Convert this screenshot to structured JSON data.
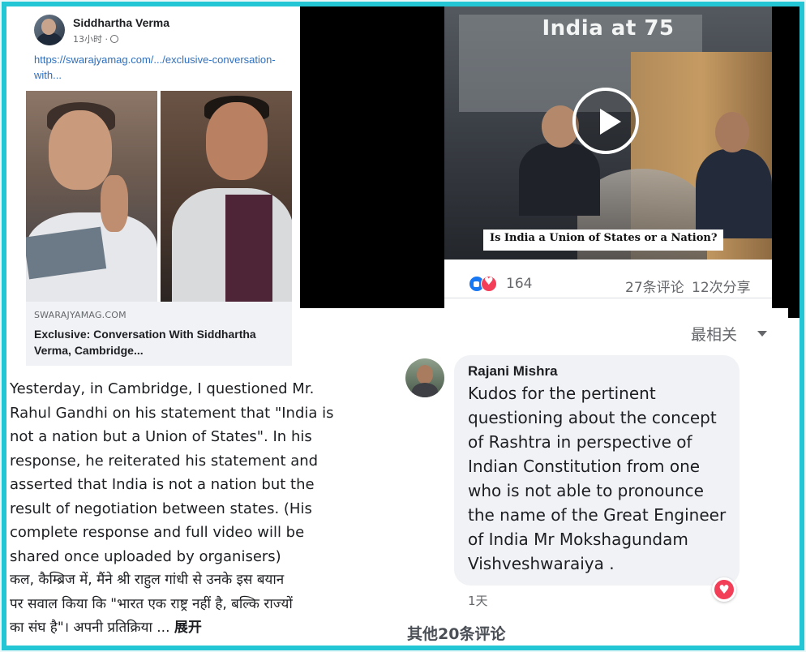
{
  "post": {
    "author": "Siddhartha Verma",
    "time": "13小时 ·",
    "link": "https://swarajyamag.com/.../exclusive-conversation-with...",
    "card_domain": "SWARAJYAMAG.COM",
    "card_title": "Exclusive: Conversation With Siddhartha Verma, Cambridge..."
  },
  "caption": {
    "english": "Yesterday, in Cambridge, I questioned Mr.\nRahul Gandhi on his statement that \"India is\nnot a nation but a Union of States\". In his\nresponse, he reiterated his statement and\nasserted that India is not a nation but the\nresult of negotiation between states. (His\ncomplete response and full video will be\nshared once uploaded by organisers)",
    "hindi": "कल, कैम्ब्रिज में, मैंने श्री राहुल गांधी से उनके इस बयान\nपर सवाल किया कि \"भारत एक राष्ट्र नहीं है, बल्कि राज्यों\nका संघ है\"। अपनी प्रतिक्रिया ...",
    "see_more": "展开"
  },
  "video": {
    "title": "India at 75",
    "caption": "Is India a Union of States or a Nation?",
    "reaction_count": "164",
    "comment_count": "27条评论",
    "share_count": "12次分享"
  },
  "comments": {
    "sort_label": "最相关",
    "items": [
      {
        "author": "Rajani Mishra",
        "text": "Kudos for the pertinent\nquestioning about the concept\nof Rashtra in perspective of\nIndian Constitution from one\nwho is not able to pronounce\nthe name of the Great Engineer\nof India Mr Mokshagundam\nVishveshwaraiya .",
        "time": "1天"
      }
    ],
    "more_label": "其他20条评论"
  },
  "colors": {
    "frame_border": "#22c6d4",
    "link": "#2e6fbf",
    "like": "#1877f2",
    "love": "#f33e58"
  }
}
